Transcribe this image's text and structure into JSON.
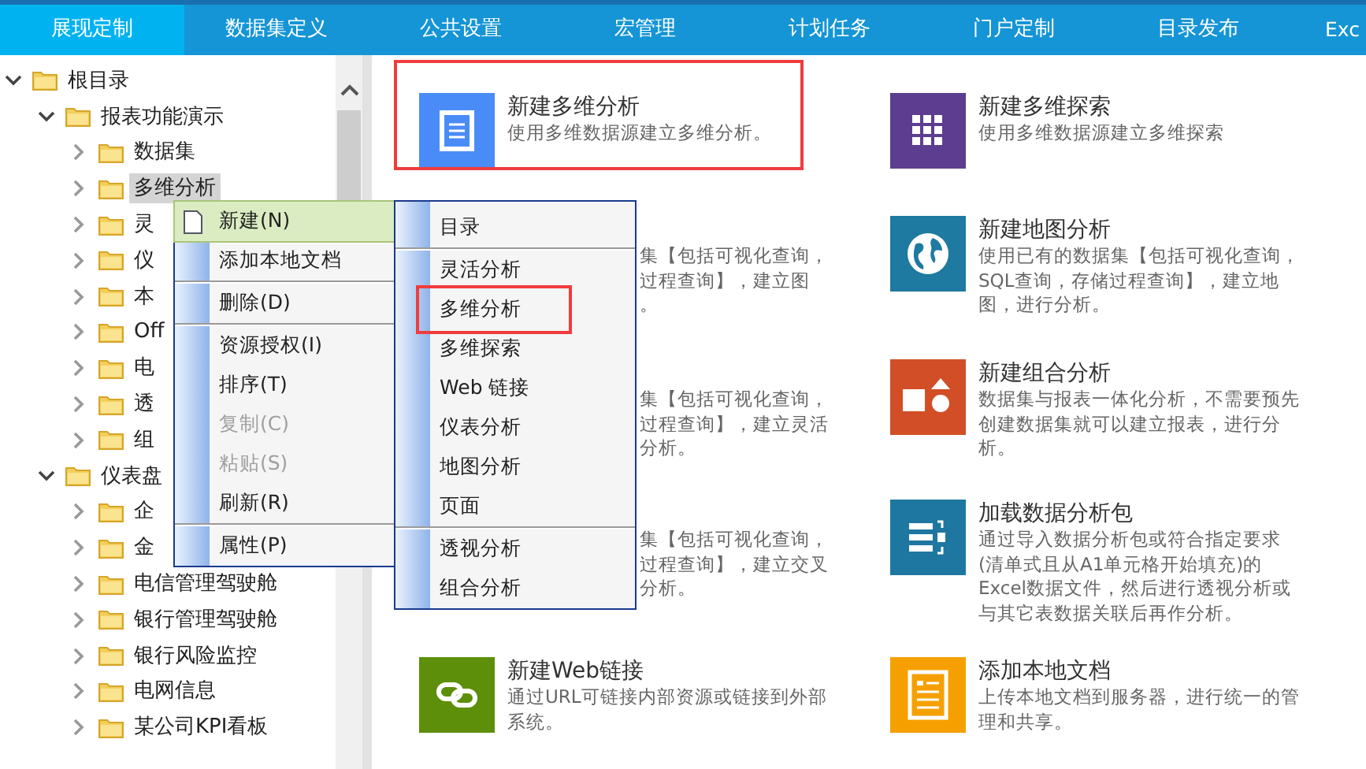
{
  "nav_tabs": [
    {
      "label": "展现定制",
      "selected": true
    },
    {
      "label": "数据集定义",
      "selected": false
    },
    {
      "label": "公共设置",
      "selected": false
    },
    {
      "label": "宏管理",
      "selected": false
    },
    {
      "label": "计划任务",
      "selected": false
    },
    {
      "label": "门户定制",
      "selected": false
    },
    {
      "label": "目录发布",
      "selected": false
    },
    {
      "label": "Exc",
      "selected": false
    }
  ],
  "tree": [
    {
      "label": "根目录",
      "expanded": true,
      "selected": false,
      "children": [
        {
          "label": "报表功能演示",
          "expanded": true,
          "selected": false,
          "children": [
            {
              "label": "数据集",
              "expanded": false,
              "selected": false
            },
            {
              "label": "多维分析",
              "expanded": false,
              "selected": true
            },
            {
              "label": "灵",
              "expanded": false,
              "selected": false
            },
            {
              "label": "仪",
              "expanded": false,
              "selected": false
            },
            {
              "label": "本",
              "expanded": false,
              "selected": false
            },
            {
              "label": "Off",
              "expanded": false,
              "selected": false
            },
            {
              "label": "电",
              "expanded": false,
              "selected": false
            },
            {
              "label": "透",
              "expanded": false,
              "selected": false
            },
            {
              "label": "组",
              "expanded": false,
              "selected": false
            }
          ]
        },
        {
          "label": "仪表盘",
          "expanded": true,
          "selected": false,
          "children": [
            {
              "label": "企",
              "expanded": false,
              "selected": false
            },
            {
              "label": "金",
              "expanded": false,
              "selected": false
            },
            {
              "label": "电信管理驾驶舱",
              "expanded": false,
              "selected": false
            },
            {
              "label": "银行管理驾驶舱",
              "expanded": false,
              "selected": false
            },
            {
              "label": "银行风险监控",
              "expanded": false,
              "selected": false
            },
            {
              "label": "电网信息",
              "expanded": false,
              "selected": false
            },
            {
              "label": "某公司KPI看板",
              "expanded": false,
              "selected": false
            }
          ]
        }
      ]
    }
  ],
  "cards": [
    {
      "kind": "full",
      "color": "#4a8cf7",
      "title": "新建多维分析",
      "description": "使用多维数据源建立多维分析。",
      "highlighted": true
    },
    {
      "kind": "full",
      "color": "#5c3d8f",
      "title": "新建多维探索",
      "description": "使用多维数据源建立多维探索",
      "highlighted": false
    },
    {
      "kind": "covered",
      "lines": [
        "集【包括可视化查询，",
        "过程查询】，建立图",
        "。"
      ]
    },
    {
      "kind": "full",
      "color": "#1e7aa0",
      "title": "新建地图分析",
      "description": "使用已有的数据集【包括可视化查询，SQL查询，存储过程查询】，建立地图，进行分析。",
      "highlighted": false
    },
    {
      "kind": "covered",
      "lines": [
        "集【包括可视化查询，",
        "过程查询】，建立灵活",
        "分析。"
      ]
    },
    {
      "kind": "full",
      "color": "#d24e26",
      "title": "新建组合分析",
      "description": "数据集与报表一体化分析，不需要预先创建数据集就可以建立报表，进行分析。",
      "highlighted": false
    },
    {
      "kind": "covered",
      "lines": [
        "集【包括可视化查询，",
        "过程查询】，建立交叉",
        "分析。"
      ]
    },
    {
      "kind": "full",
      "color": "#1e77a0",
      "title": "加载数据分析包",
      "description": "通过导入数据分析包或符合指定要求(清单式且从A1单元格开始填充)的Excel数据文件，然后进行透视分析或与其它表数据关联后再作分析。",
      "highlighted": false
    },
    {
      "kind": "full",
      "color": "#5d8f0a",
      "title": "新建Web链接",
      "description": "通过URL可链接内部资源或链接到外部系统。",
      "highlighted": false
    },
    {
      "kind": "full",
      "color": "#f5a000",
      "title": "添加本地文档",
      "description": "上传本地文档到服务器，进行统一的管理和共享。",
      "highlighted": false
    }
  ],
  "context_menu": [
    {
      "kind": "item",
      "label": "新建(N)",
      "selected": true,
      "disabled": false
    },
    {
      "kind": "item",
      "label": "添加本地文档",
      "selected": false,
      "disabled": false
    },
    {
      "kind": "separator"
    },
    {
      "kind": "item",
      "label": "删除(D)",
      "selected": false,
      "disabled": false
    },
    {
      "kind": "separator"
    },
    {
      "kind": "item",
      "label": "资源授权(I)",
      "selected": false,
      "disabled": false
    },
    {
      "kind": "item",
      "label": "排序(T)",
      "selected": false,
      "disabled": false
    },
    {
      "kind": "item",
      "label": "复制(C)",
      "selected": false,
      "disabled": true
    },
    {
      "kind": "item",
      "label": "粘贴(S)",
      "selected": false,
      "disabled": true
    },
    {
      "kind": "item",
      "label": "刷新(R)",
      "selected": false,
      "disabled": false
    },
    {
      "kind": "separator"
    },
    {
      "kind": "item",
      "label": "属性(P)",
      "selected": false,
      "disabled": false
    }
  ],
  "submenu": [
    {
      "kind": "item",
      "label": "目录",
      "highlighted": false
    },
    {
      "kind": "separator"
    },
    {
      "kind": "item",
      "label": "灵活分析",
      "highlighted": false
    },
    {
      "kind": "item",
      "label": "多维分析",
      "highlighted": true
    },
    {
      "kind": "item",
      "label": "多维探索",
      "highlighted": false
    },
    {
      "kind": "item",
      "label": "Web 链接",
      "highlighted": false
    },
    {
      "kind": "item",
      "label": "仪表分析",
      "highlighted": false
    },
    {
      "kind": "item",
      "label": "地图分析",
      "highlighted": false
    },
    {
      "kind": "item",
      "label": "页面",
      "highlighted": false
    },
    {
      "kind": "separator"
    },
    {
      "kind": "item",
      "label": "透视分析",
      "highlighted": false
    },
    {
      "kind": "item",
      "label": "组合分析",
      "highlighted": false
    }
  ]
}
